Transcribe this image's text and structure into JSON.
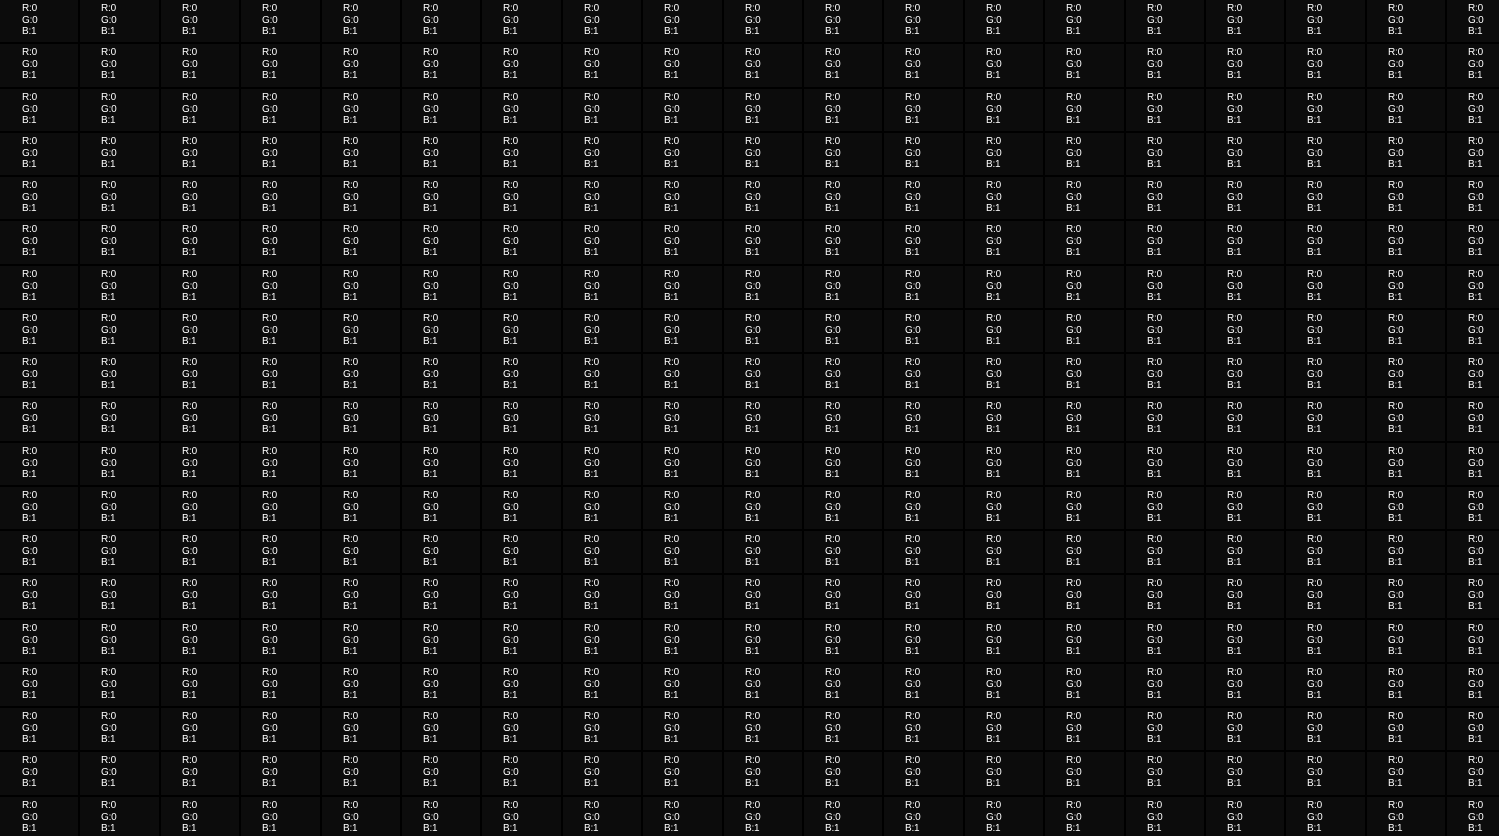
{
  "screen": {
    "background": "#000000",
    "cell_background": "#0c0c0c",
    "text_color": "#ffffff"
  },
  "grid": {
    "rows": 19,
    "columns": 19,
    "cell_text": {
      "r": "R:0",
      "g": "G:0",
      "b": "B:1"
    }
  }
}
